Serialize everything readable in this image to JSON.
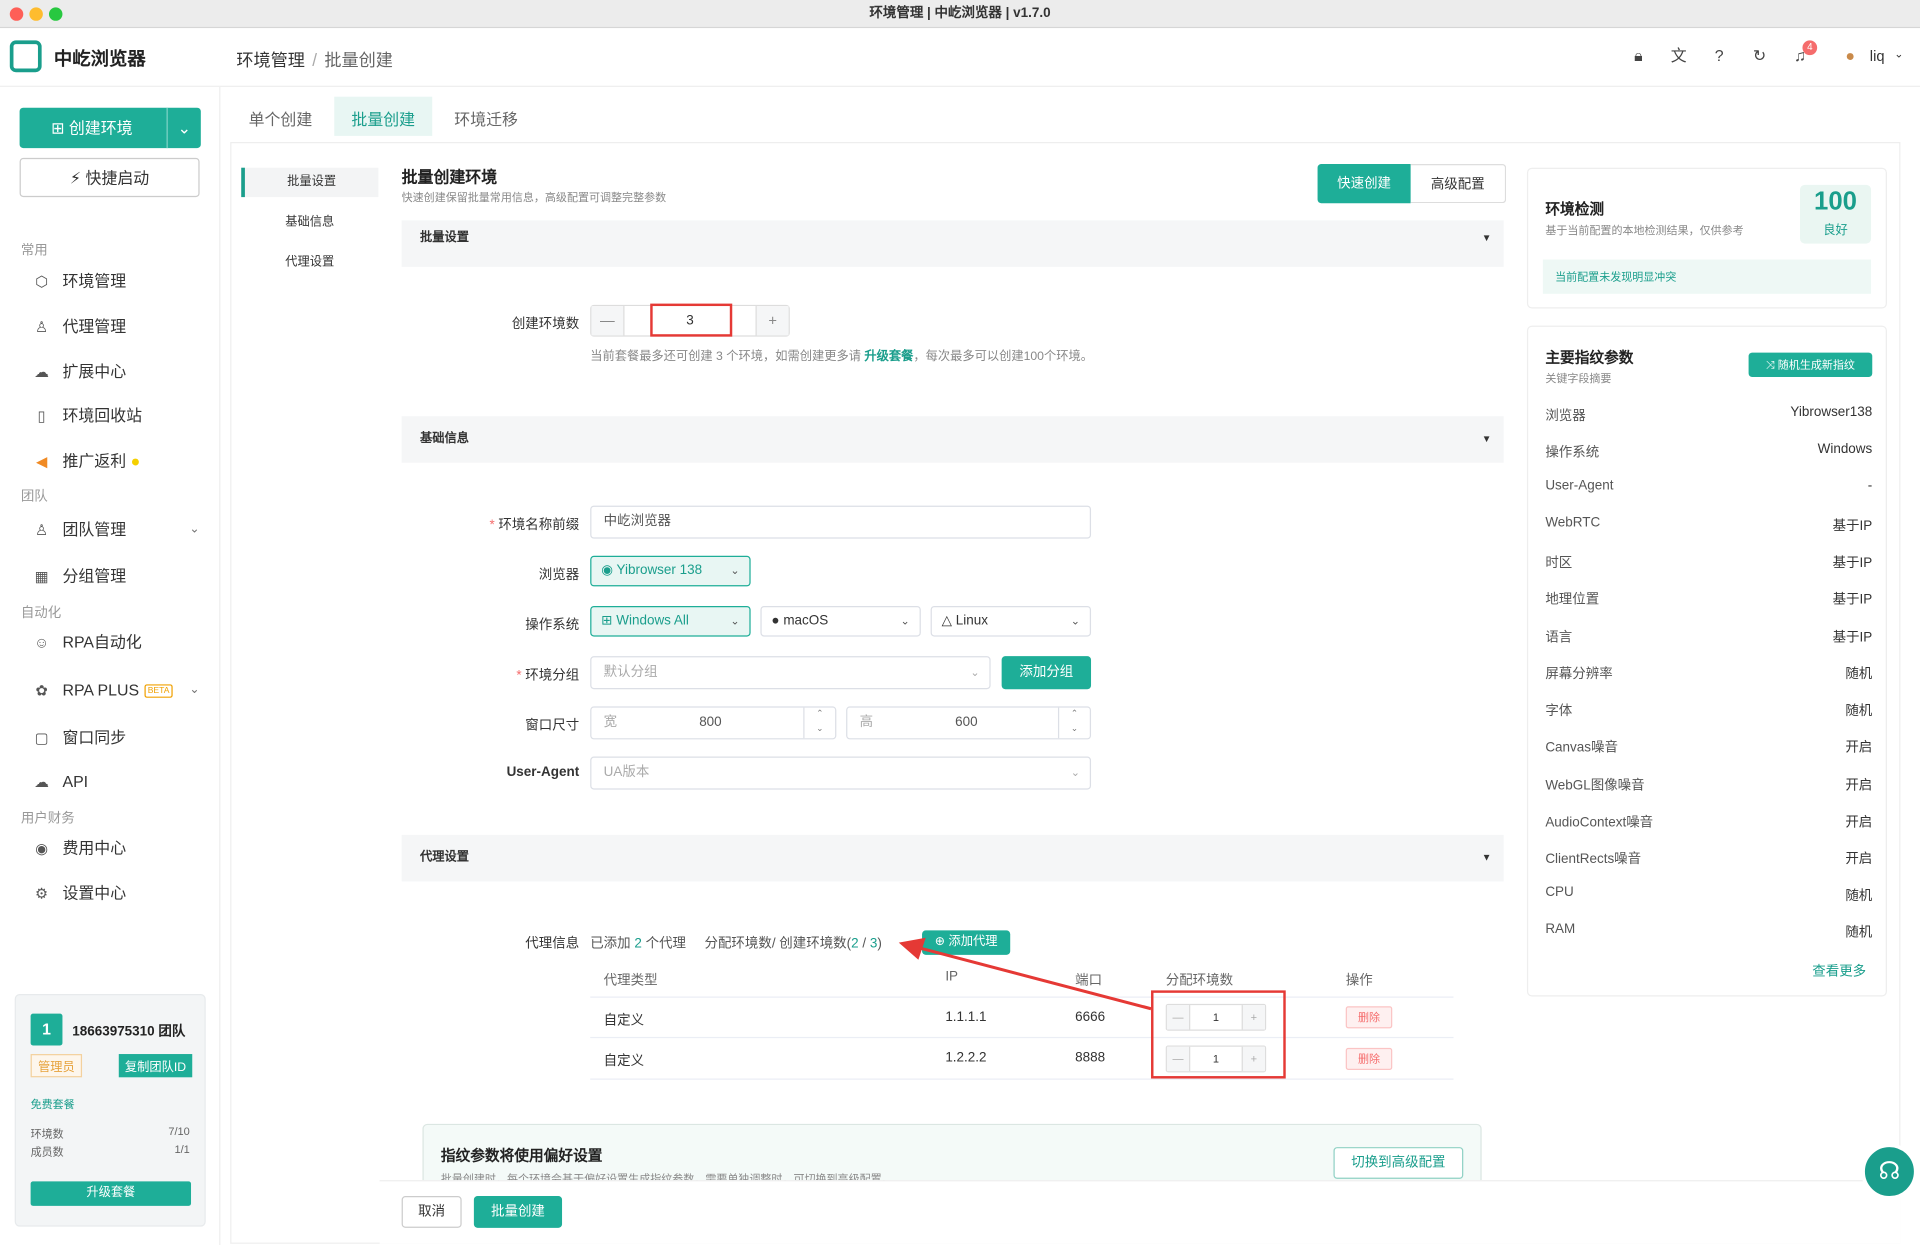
{
  "window": {
    "title": "环境管理 | 中屹浏览器 | v1.7.0"
  },
  "brand": {
    "name": "中屹浏览器"
  },
  "breadcrumb": {
    "parent": "环境管理",
    "separator": "/",
    "current": "批量创建"
  },
  "header": {
    "notification_count": "4",
    "user": "liq",
    "icons": [
      "lock-icon",
      "translate-icon",
      "help-icon",
      "refresh-icon",
      "bell-icon",
      "avatar"
    ]
  },
  "sidebar": {
    "create_label": "创建环境",
    "quick_label": "快捷启动",
    "groups": {
      "common": "常用",
      "team": "团队",
      "auto": "自动化",
      "finance": "用户财务"
    },
    "items": {
      "env": "环境管理",
      "proxy": "代理管理",
      "ext": "扩展中心",
      "recycle": "环境回收站",
      "promo": "推广返利",
      "teammgr": "团队管理",
      "groupmgr": "分组管理",
      "rpa": "RPA自动化",
      "rpaplus": "RPA PLUS",
      "rpaplus_badge": "BETA",
      "sync": "窗口同步",
      "api": "API",
      "fee": "费用中心",
      "settings": "设置中心"
    },
    "team": {
      "num": "1",
      "name": "18663975310 团队",
      "role": "管理员",
      "copy": "复制团队ID",
      "plan": "免费套餐",
      "env_label": "环境数",
      "env_val": "7/10",
      "member_label": "成员数",
      "member_val": "1/1",
      "upgrade": "升级套餐"
    }
  },
  "tabs": [
    "单个创建",
    "批量创建",
    "环境迁移"
  ],
  "anchors": [
    "批量设置",
    "基础信息",
    "代理设置"
  ],
  "main": {
    "title": "批量创建环境",
    "subtitle": "快速创建保留批量常用信息，高级配置可调整完整参数",
    "mode_quick": "快速创建",
    "mode_adv": "高级配置",
    "sec_batch": "批量设置",
    "sec_basic": "基础信息",
    "sec_proxy": "代理设置",
    "count_label": "创建环境数",
    "count_value": "3",
    "hint_pre": "当前套餐最多还可创建 3 个环境，如需创建更多请",
    "hint_link": "升级套餐",
    "hint_post": "，每次最多可以创建100个环境。",
    "name_label": "环境名称前缀",
    "name_value": "中屹浏览器",
    "browser_label": "浏览器",
    "browser_value": "Yibrowser 138",
    "os_label": "操作系统",
    "os_win": "Windows All",
    "os_mac": "macOS",
    "os_linux": "Linux",
    "group_label": "环境分组",
    "group_value": "默认分组",
    "add_group": "添加分组",
    "win_label": "窗口尺寸",
    "w_ph": "宽",
    "w_val": "800",
    "h_ph": "高",
    "h_val": "600",
    "ua_label": "User-Agent",
    "ua_ph": "UA版本",
    "proxy_label": "代理信息",
    "proxy_added_pre": "已添加",
    "proxy_added_n": "2",
    "proxy_added_post": "个代理",
    "proxy_alloc_pre": "分配环境数/ 创建环境数(",
    "proxy_alloc_a": "2",
    "proxy_alloc_sep": " / ",
    "proxy_alloc_b": "3",
    "proxy_alloc_post": ")",
    "add_proxy": "添加代理",
    "table_headers": [
      "代理类型",
      "IP",
      "端口",
      "分配环境数",
      "操作"
    ],
    "rows": [
      {
        "type": "自定义",
        "ip": "1.1.1.1",
        "port": "6666",
        "alloc": "1",
        "op": "删除"
      },
      {
        "type": "自定义",
        "ip": "1.2.2.2",
        "port": "8888",
        "alloc": "1",
        "op": "删除"
      }
    ],
    "fp_title": "指纹参数将使用偏好设置",
    "fp_desc": "批量创建时，每个环境会基于偏好设置生成指纹参数，需要单独调整时，可切换到高级配置。",
    "fp_btn": "切换到高级配置",
    "cancel": "取消",
    "create": "批量创建"
  },
  "right": {
    "check_title": "环境检测",
    "check_sub": "基于当前配置的本地检测结果，仅供参考",
    "score": "100",
    "score_label": "良好",
    "check_ok": "当前配置未发现明显冲突",
    "fp_title": "主要指纹参数",
    "fp_sub": "关键字段摘要",
    "random_btn": "随机生成新指纹",
    "params": [
      {
        "k": "浏览器",
        "v": "Yibrowser138"
      },
      {
        "k": "操作系统",
        "v": "Windows"
      },
      {
        "k": "User-Agent",
        "v": "-"
      },
      {
        "k": "WebRTC",
        "v": "基于IP"
      },
      {
        "k": "时区",
        "v": "基于IP"
      },
      {
        "k": "地理位置",
        "v": "基于IP"
      },
      {
        "k": "语言",
        "v": "基于IP"
      },
      {
        "k": "屏幕分辨率",
        "v": "随机"
      },
      {
        "k": "字体",
        "v": "随机"
      },
      {
        "k": "Canvas噪音",
        "v": "开启"
      },
      {
        "k": "WebGL图像噪音",
        "v": "开启"
      },
      {
        "k": "AudioContext噪音",
        "v": "开启"
      },
      {
        "k": "ClientRects噪音",
        "v": "开启"
      },
      {
        "k": "CPU",
        "v": "随机"
      },
      {
        "k": "RAM",
        "v": "随机"
      }
    ],
    "more": "查看更多"
  },
  "colors": {
    "accent": "#1eae98",
    "highlight": "#e53935",
    "danger": "#f56c6c"
  }
}
